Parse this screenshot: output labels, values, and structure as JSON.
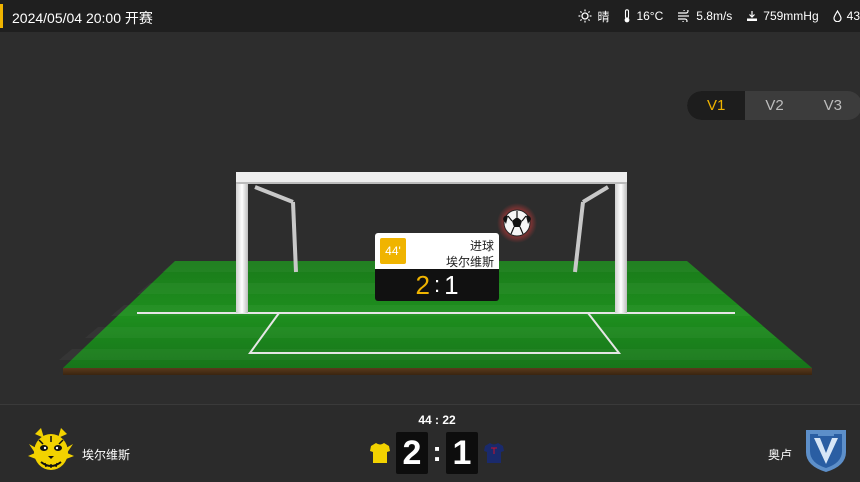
{
  "header": {
    "kickoff": "2024/05/04 20:00 开赛",
    "weather": [
      {
        "icon": "sun-icon",
        "label": "晴"
      },
      {
        "icon": "thermometer-icon",
        "label": "16°C"
      },
      {
        "icon": "wind-icon",
        "label": "5.8m/s"
      },
      {
        "icon": "pressure-icon",
        "label": "759mmHg"
      },
      {
        "icon": "humidity-icon",
        "label": "43"
      }
    ]
  },
  "view_switch": [
    "V1",
    "V2",
    "V3"
  ],
  "active_view": "V1",
  "event": {
    "minute": "44'",
    "type": "进球",
    "team": "埃尔维斯",
    "home_score": "2",
    "separator": ":",
    "away_score": "1"
  },
  "match": {
    "clock": "44 : 22",
    "home_team": "埃尔维斯",
    "away_team": "奥卢",
    "home_score": "2",
    "separator": ":",
    "away_score": "1"
  },
  "colors": {
    "accent": "#f0b400",
    "home_kit": "#f2d200",
    "away_kit": "#1a2a6c",
    "pitch_green": "#1f8f1f"
  }
}
